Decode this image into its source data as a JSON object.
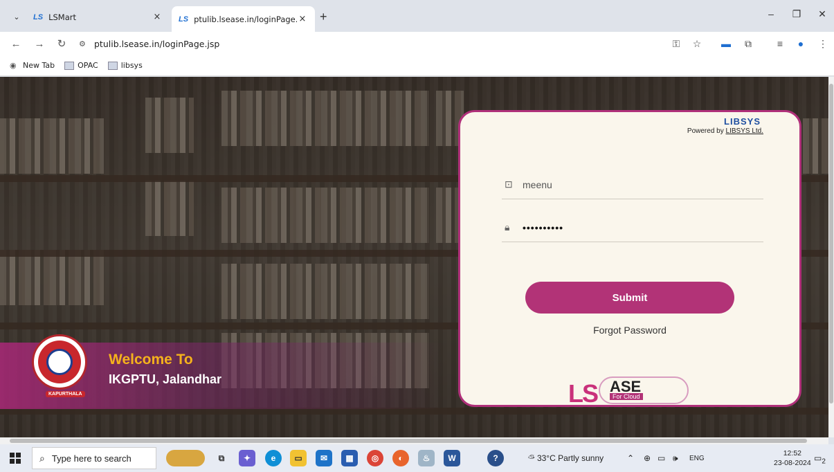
{
  "browser": {
    "tabs": [
      {
        "favicon": "LS",
        "title": "LSMart",
        "close": "×"
      },
      {
        "favicon": "LS",
        "title": "ptulib.lsease.in/loginPage.jsp",
        "close": "×"
      }
    ],
    "new_tab": "+",
    "url": "ptulib.lsease.in/loginPage.jsp",
    "bookmarks": [
      "New Tab",
      "OPAC",
      "libsys"
    ]
  },
  "page": {
    "welcome_line1": "Welcome To",
    "welcome_line2": "IKGPTU, Jalandhar",
    "emblem_text": "KAPURTHALA",
    "libsys_logo": "LIBSYS",
    "powered_prefix": "Powered by ",
    "powered_link": "LIBSYS Ltd.",
    "username_value": "meenu",
    "password_masked": "••••••••••",
    "submit_label": "Submit",
    "forgot_label": "Forgot Password",
    "brand_ls": "LS",
    "brand_ase": "ASE",
    "brand_sub": "For Cloud"
  },
  "taskbar": {
    "search_placeholder": "Type here to search",
    "weather": "33°C  Partly sunny",
    "lang": "ENG",
    "time": "12:52",
    "date": "23-08-2024",
    "notifications": "2"
  }
}
